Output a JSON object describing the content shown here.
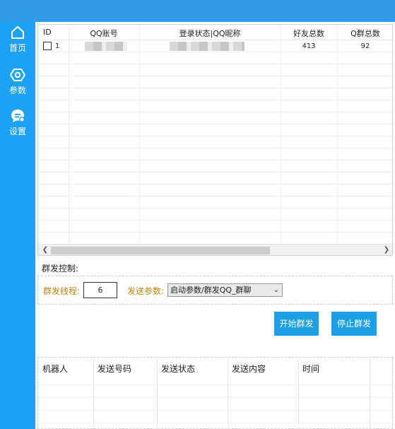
{
  "nav": {
    "items": [
      {
        "label": "首页",
        "icon": "home-icon"
      },
      {
        "label": "参数",
        "icon": "settings-hex-icon"
      },
      {
        "label": "设置",
        "icon": "chat-settings-icon"
      }
    ]
  },
  "accounts": {
    "headers": {
      "id": "ID",
      "qq": "QQ账号",
      "status": "登录状态|QQ昵称",
      "friends": "好友总数",
      "groups": "Q群总数"
    },
    "rows": [
      {
        "id": "1",
        "friends": "413",
        "groups": "92"
      }
    ]
  },
  "control": {
    "title": "群发控制:",
    "threads_label": "群发线程:",
    "threads_value": "6",
    "params_label": "发送参数:",
    "params_value": "启动参数/群发QQ_群聊",
    "start_button": "开始群发",
    "stop_button": "停止群发"
  },
  "log": {
    "headers": [
      "机器人",
      "发送号码",
      "发送状态",
      "发送内容",
      "时间"
    ]
  },
  "colors": {
    "sidebar": "#1da1f2",
    "topbar": "#2f9ae5",
    "button": "#1d9fe4",
    "label_orange": "#b8860b"
  }
}
